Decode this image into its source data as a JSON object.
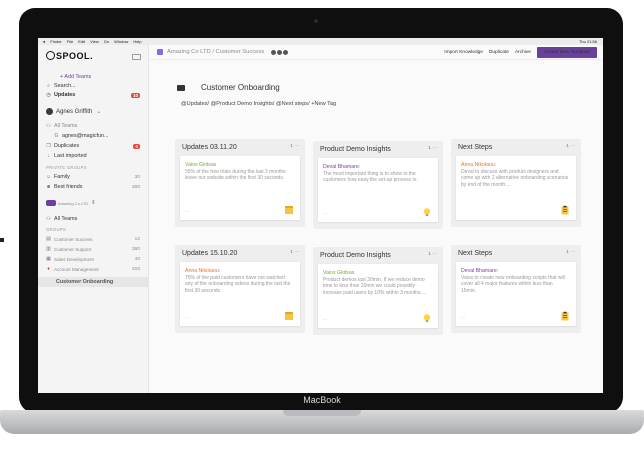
{
  "laptop": {
    "brand": "MacBook"
  },
  "menubar": {
    "items": [
      "Finder",
      "File",
      "Edit",
      "View",
      "Go",
      "Window",
      "Help"
    ],
    "clock": "Thu 21:56"
  },
  "sidebar": {
    "logo": "SPOOL.",
    "add_teams": "+ Add Teams",
    "search": "Search...",
    "updates": {
      "label": "Updates",
      "badge": "10"
    },
    "user": "Agnes Griffith",
    "all_teams": "All Teams",
    "email": "agnes@magicfun...",
    "duplicates": {
      "label": "Duplicates",
      "badge": "6"
    },
    "last_imported": "Last imported",
    "private_groups": "PRIVATE GROUPS",
    "family": {
      "label": "Family",
      "count": "30"
    },
    "best_friends": {
      "label": "Best friends",
      "count": "200"
    },
    "workspace": "Amazing Co LTD",
    "all_teams_2": "All Teams",
    "groups": "GROUPS",
    "group_items": [
      {
        "label": "Customer Success",
        "count": "12"
      },
      {
        "label": "Customer Support",
        "count": "380"
      },
      {
        "label": "Sales Development",
        "count": "40"
      },
      {
        "label": "Account Management",
        "count": "210"
      }
    ],
    "selected": "Customer Onboarding"
  },
  "topbar": {
    "breadcrumb": "Amazing Co LTD / Customer Success",
    "import": "Import Knowledge",
    "duplicate": "Duplicate",
    "archive": "Archive",
    "create": "Create New Template"
  },
  "page": {
    "title": "Customer Onboarding",
    "tags": "@Updates/ @Product Demo Insights/ @Next steps/ +New Tag"
  },
  "boards": [
    {
      "title": "Updates 03.11.20",
      "count": "1 ···",
      "author": "Vaios Gkitsas",
      "author_color": "#7aab3a",
      "text": "55% of the free trials during the last 2 months leave our website within the first 30 seconds.",
      "sticker": "note"
    },
    {
      "title": "Product Demo Insights",
      "count": "1 ···",
      "author": "Deval Bhamare:",
      "author_color": "#7a3fa0",
      "text": "The most important thing is to show to the customers how easy the set-up process is.",
      "sticker": "bulb"
    },
    {
      "title": "Next Steps",
      "count": "1 ···",
      "author": "Anna Nikolaou:",
      "author_color": "#e0762c",
      "text": "Deval to discuss with product designers and come up with 2 alternative onboarding scenarios by end of the month....",
      "sticker": "clip"
    },
    {
      "title": "Updates 15.10.20",
      "count": "1 ···",
      "author": "Anna Nikolaou:",
      "author_color": "#e0762c",
      "text": "75% of the paid customers have not watched any of the onboarding videos during the last the first 30 seconds",
      "sticker": "note"
    },
    {
      "title": "Product Demo Insights",
      "count": "1 ···",
      "author": "Vaios Gkitsas",
      "author_color": "#7aab3a",
      "text": "Product demos last 30min. If we reduce demo time to less than 20min we could possibly increase paid users by 10% within 3 months....",
      "sticker": "bulb"
    },
    {
      "title": "Next Steps",
      "count": "1 ···",
      "author": "Deval Bhamare:",
      "author_color": "#7a3fa0",
      "text": "Vaios to create new onboarding scripts that will cover all 4 major features within less than 15min.",
      "sticker": "clip"
    }
  ]
}
